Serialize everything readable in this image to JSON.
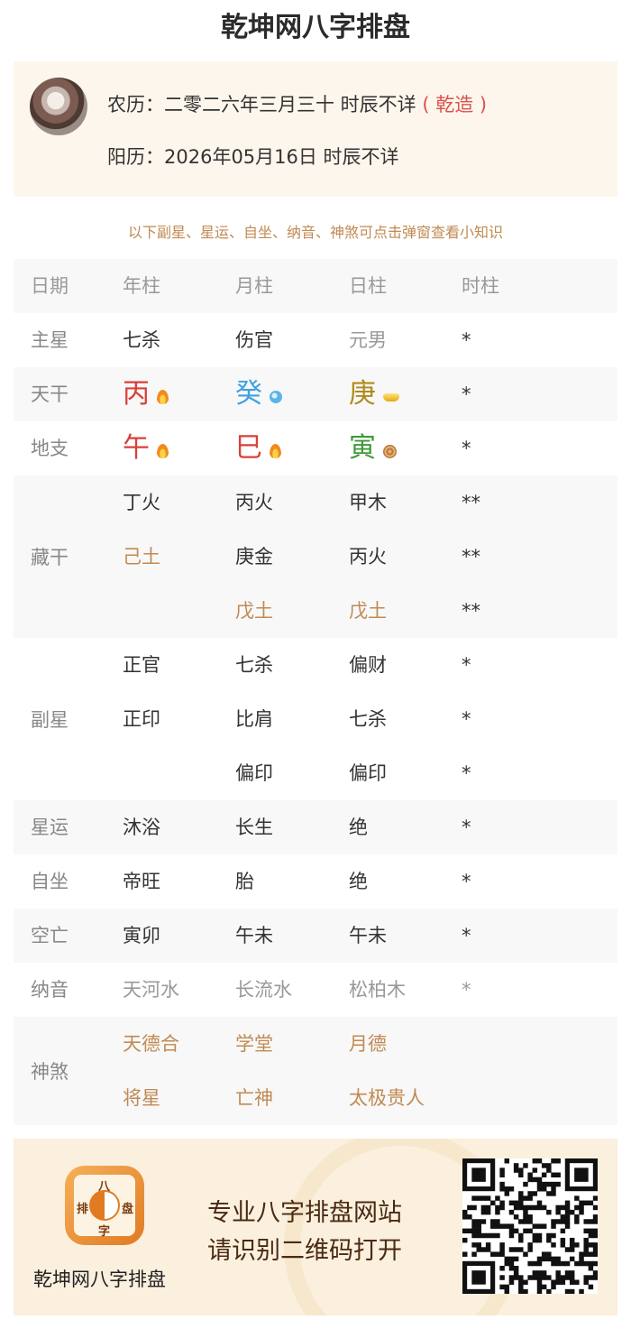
{
  "page": {
    "title": "乾坤网八字排盘"
  },
  "info": {
    "lunar": "农历：二零二六年三月三十 时辰不详",
    "gender": "( 乾造 )",
    "solar": "阳历：2026年05月16日 时辰不详"
  },
  "hint": "以下副星、星运、自坐、纳音、神煞可点击弹窗查看小知识",
  "table": {
    "header": [
      "日期",
      "年柱",
      "月柱",
      "日柱",
      "时柱"
    ],
    "zhuxing": {
      "label": "主星",
      "values": [
        "七杀",
        "伤官",
        "元男",
        "*"
      ]
    },
    "tiangan": {
      "label": "天干",
      "values": [
        "丙",
        "癸",
        "庚",
        "*"
      ],
      "icons": [
        "fire-icon",
        "water-drop-icon",
        "gold-ingot-icon",
        ""
      ]
    },
    "dizhi": {
      "label": "地支",
      "values": [
        "午",
        "巳",
        "寅",
        "*"
      ],
      "icons": [
        "fire-icon",
        "fire-icon",
        "wood-icon",
        ""
      ]
    },
    "canggan": {
      "label": "藏干",
      "rows": [
        [
          "丁火",
          "丙火",
          "甲木",
          "**"
        ],
        [
          "己土",
          "庚金",
          "丙火",
          "**"
        ],
        [
          "",
          "戊土",
          "戊土",
          "**"
        ]
      ]
    },
    "fuxing": {
      "label": "副星",
      "rows": [
        [
          "正官",
          "七杀",
          "偏财",
          "*"
        ],
        [
          "正印",
          "比肩",
          "七杀",
          "*"
        ],
        [
          "",
          "偏印",
          "偏印",
          "*"
        ]
      ]
    },
    "xingyun": {
      "label": "星运",
      "values": [
        "沐浴",
        "长生",
        "绝",
        "*"
      ]
    },
    "zizuo": {
      "label": "自坐",
      "values": [
        "帝旺",
        "胎",
        "绝",
        "*"
      ]
    },
    "kongwang": {
      "label": "空亡",
      "values": [
        "寅卯",
        "午未",
        "午未",
        "*"
      ]
    },
    "nayin": {
      "label": "纳音",
      "values": [
        "天河水",
        "长流水",
        "松柏木",
        "*"
      ]
    },
    "shensha": {
      "label": "神煞",
      "rows": [
        [
          "天德合",
          "学堂",
          "月德",
          ""
        ],
        [
          "将星",
          "亡神",
          "太极贵人",
          ""
        ]
      ]
    }
  },
  "colors": {
    "fire": "#d9403a",
    "water": "#3fa0e0",
    "metal": "#b08a1c",
    "wood": "#3f9a3a",
    "earth": "#c08a53"
  },
  "banner": {
    "app_name": "乾坤网八字排盘",
    "logo_chars": [
      "八",
      "排",
      "盘",
      "字"
    ],
    "slogan1": "专业八字排盘网站",
    "slogan2": "请识别二维码打开"
  }
}
